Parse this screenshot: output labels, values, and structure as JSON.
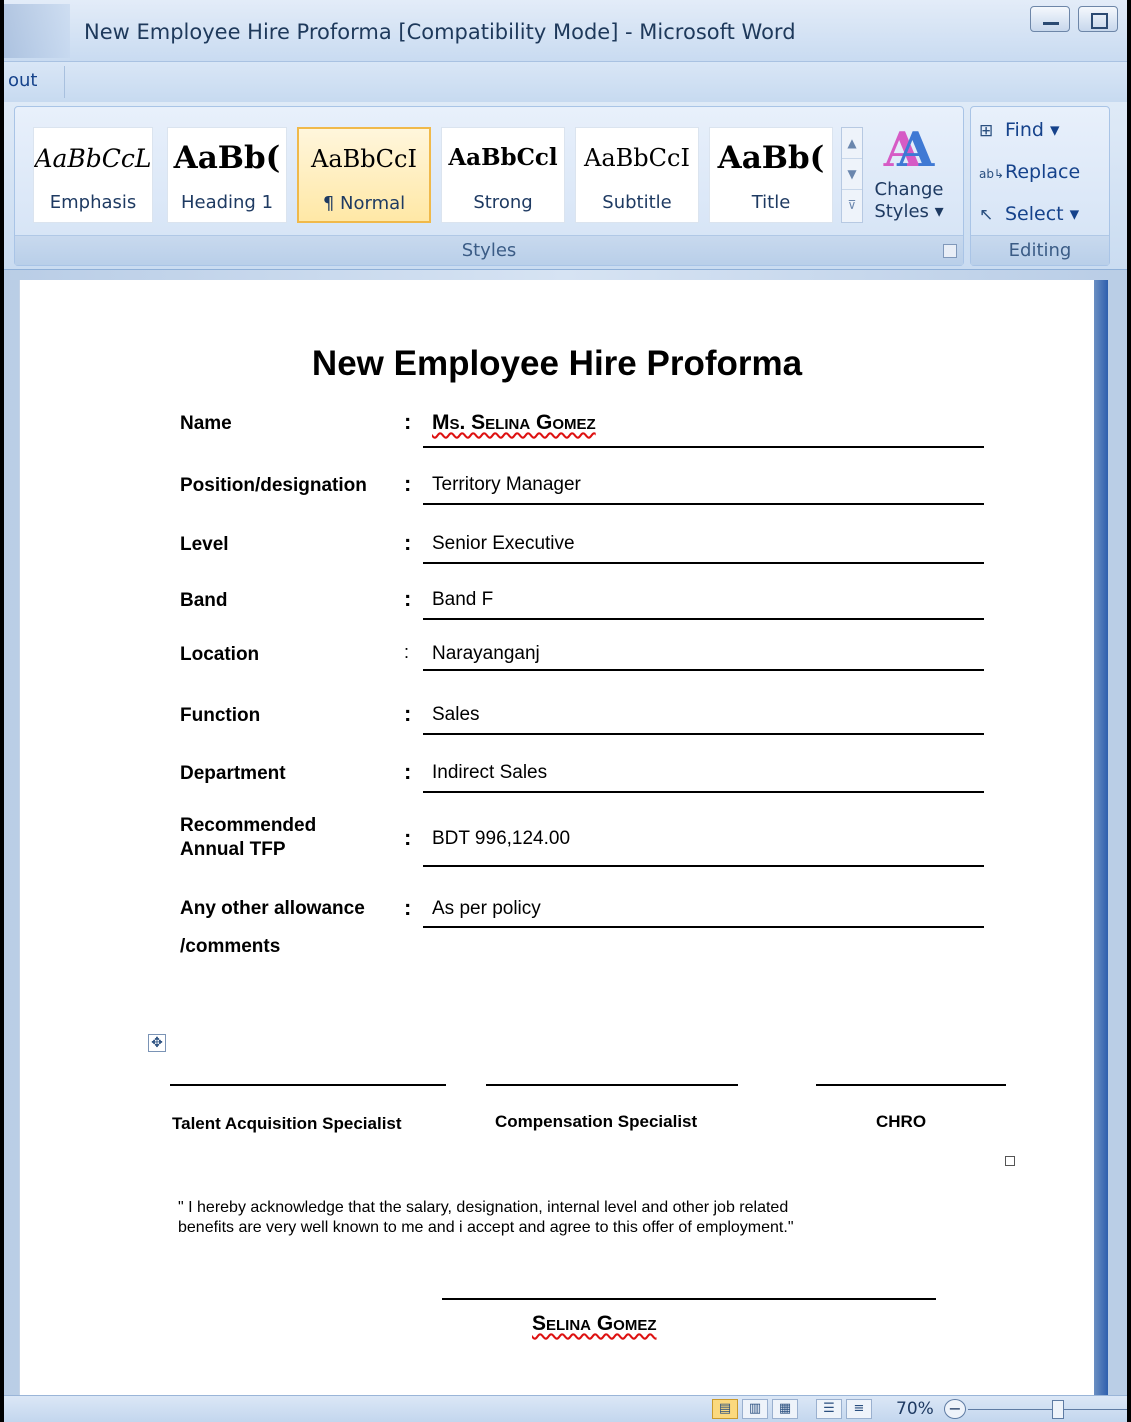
{
  "window": {
    "title": "New Employee Hire Proforma [Compatibility Mode] - Microsoft Word"
  },
  "tabs": {
    "partial_tab": "out"
  },
  "ribbon": {
    "styles_group_label": "Styles",
    "editing_group_label": "Editing",
    "style_gallery": [
      {
        "sample": "AaBbCcL",
        "label": "Emphasis"
      },
      {
        "sample": "AaBb(",
        "label": "Heading 1"
      },
      {
        "sample": "AaBbCcI",
        "label": "¶ Normal"
      },
      {
        "sample": "AaBbCcl",
        "label": "Strong"
      },
      {
        "sample": "AaBbCcI",
        "label": "Subtitle"
      },
      {
        "sample": "AaBb(",
        "label": "Title"
      }
    ],
    "change_styles": {
      "glyph": "AA",
      "line1": "Change",
      "line2": "Styles ▾"
    },
    "editing": {
      "find": "Find ▾",
      "replace": "Replace",
      "select": "Select ▾"
    }
  },
  "document": {
    "title": "New Employee Hire Proforma",
    "fields": [
      {
        "label": "Name",
        "value": "Ms. Selina Gomez"
      },
      {
        "label": "Position/designation",
        "value": "Territory Manager"
      },
      {
        "label": "Level",
        "value": "Senior Executive"
      },
      {
        "label": "Band",
        "value": "Band F"
      },
      {
        "label": "Location",
        "value": "Narayanganj"
      },
      {
        "label": "Function",
        "value": "Sales"
      },
      {
        "label": "Department",
        "value": "Indirect Sales"
      },
      {
        "label_line1": "Recommended",
        "label_line2": "Annual TFP",
        "value": "BDT  996,124.00"
      },
      {
        "label_line1": "Any other allowance",
        "label_line2": "/comments",
        "value": "As per policy"
      }
    ],
    "signatories": [
      "Talent Acquisition Specialist",
      "Compensation Specialist",
      "CHRO"
    ],
    "acknowledgement_line1": "\" I hereby acknowledge that the salary, designation, internal level and other job related",
    "acknowledgement_line2": "benefits are very well  known to me and i accept and agree to this offer of employment.\"",
    "signee_name": "Selina Gomez"
  },
  "statusbar": {
    "zoom": "70%",
    "zoom_level_percent": 70
  }
}
